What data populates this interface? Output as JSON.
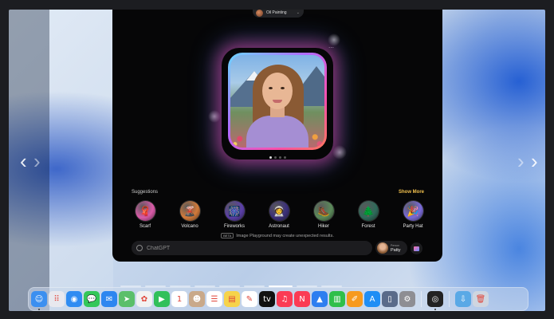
{
  "app": {
    "style_pill": {
      "label": "Oil Painting",
      "icon": "oil-painting-thumbnail",
      "chevron": "⌄"
    },
    "more_icon": "⋯",
    "page_dots": {
      "count": 4,
      "active": 1
    },
    "suggestions": {
      "title": "Suggestions",
      "show_more": "Show More",
      "items": [
        {
          "label": "Scarf",
          "icon": "scarf-icon",
          "glyph": "🧣",
          "color": "#d95aa8"
        },
        {
          "label": "Volcano",
          "icon": "volcano-icon",
          "glyph": "🌋",
          "color": "#d27a3a"
        },
        {
          "label": "Fireworks",
          "icon": "fireworks-icon",
          "glyph": "🎆",
          "color": "#5a3fa8"
        },
        {
          "label": "Astronaut",
          "icon": "astronaut-icon",
          "glyph": "👩‍🚀",
          "color": "#3b2f7a"
        },
        {
          "label": "Hiker",
          "icon": "hiker-icon",
          "glyph": "🥾",
          "color": "#5b8a5a"
        },
        {
          "label": "Forest",
          "icon": "forest-icon",
          "glyph": "🌲",
          "color": "#2f6a5a"
        },
        {
          "label": "Party Hat",
          "icon": "party-hat-icon",
          "glyph": "🎉",
          "color": "#7a6ad8"
        }
      ]
    },
    "notice": {
      "badge": "BETA",
      "text": "Image Playground may create unexpected results."
    },
    "prompt": {
      "placeholder": "ChatGPT",
      "value": ""
    },
    "person": {
      "caption": "Person",
      "name": "Patty"
    }
  },
  "nav": {
    "left_chevron": "‹",
    "right_chevron": "›"
  },
  "indicators": {
    "count": 9,
    "active": 7
  },
  "dock": {
    "items": [
      {
        "name": "finder-icon",
        "glyph": "☺",
        "color": "#3b8ff0",
        "running": true
      },
      {
        "name": "launchpad-icon",
        "glyph": "⠿",
        "color": "#e8e8ee",
        "running": false
      },
      {
        "name": "safari-icon",
        "glyph": "◉",
        "color": "#2f8cf2",
        "running": false
      },
      {
        "name": "messages-icon",
        "glyph": "💬",
        "color": "#34c759",
        "running": false
      },
      {
        "name": "mail-icon",
        "glyph": "✉",
        "color": "#2d86f0",
        "running": false
      },
      {
        "name": "maps-icon",
        "glyph": "➤",
        "color": "#5bbf6a",
        "running": false
      },
      {
        "name": "photos-icon",
        "glyph": "✿",
        "color": "#f2f2f2",
        "running": false
      },
      {
        "name": "facetime-icon",
        "glyph": "▶",
        "color": "#31c05a",
        "running": false
      },
      {
        "name": "calendar-icon",
        "glyph": "1",
        "color": "#ffffff",
        "running": false
      },
      {
        "name": "contacts-icon",
        "glyph": "☻",
        "color": "#c9a98a",
        "running": false
      },
      {
        "name": "reminders-icon",
        "glyph": "☰",
        "color": "#ffffff",
        "running": false
      },
      {
        "name": "notes-icon",
        "glyph": "▤",
        "color": "#f6d34a",
        "running": false
      },
      {
        "name": "freeform-icon",
        "glyph": "✎",
        "color": "#ffffff",
        "running": false
      },
      {
        "name": "apple-tv-icon",
        "glyph": "tv",
        "color": "#111111",
        "running": false
      },
      {
        "name": "music-icon",
        "glyph": "♫",
        "color": "#fb3b54",
        "running": false
      },
      {
        "name": "news-icon",
        "glyph": "N",
        "color": "#fb3b54",
        "running": false
      },
      {
        "name": "keynote-icon",
        "glyph": "▲",
        "color": "#2d7ef0",
        "running": false
      },
      {
        "name": "numbers-icon",
        "glyph": "▥",
        "color": "#2fbf4a",
        "running": false
      },
      {
        "name": "pages-icon",
        "glyph": "✐",
        "color": "#f79a1e",
        "running": false
      },
      {
        "name": "app-store-icon",
        "glyph": "A",
        "color": "#1f8ef5",
        "running": false
      },
      {
        "name": "iphone-mirroring-icon",
        "glyph": "▯",
        "color": "#5a6b8a",
        "running": false
      },
      {
        "name": "system-settings-icon",
        "glyph": "⚙",
        "color": "#8e8e93",
        "running": false
      },
      {
        "name": "image-playground-icon",
        "glyph": "◎",
        "color": "#222222",
        "running": true
      },
      {
        "name": "downloads-folder-icon",
        "glyph": "⇩",
        "color": "#5aa9e6",
        "running": false
      },
      {
        "name": "trash-icon",
        "glyph": "🗑",
        "color": "#cfd6e0",
        "running": false
      }
    ]
  }
}
